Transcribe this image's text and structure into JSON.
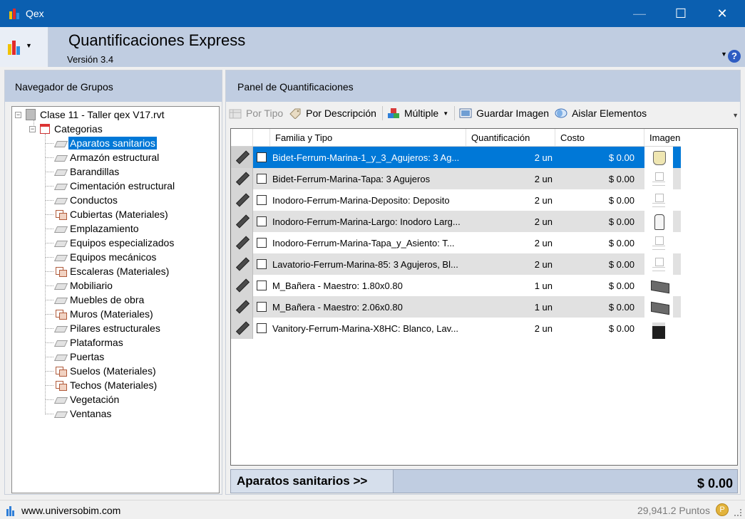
{
  "window": {
    "title": "Qex",
    "minimize_glyph": "—",
    "maximize_glyph": "☐",
    "close_glyph": "✕"
  },
  "header": {
    "app_title": "Quantificaciones Express",
    "version": "Versión 3.4",
    "help_glyph": "?"
  },
  "left_panel": {
    "title": "Navegador de Grupos",
    "root": {
      "label": "Clase 11 - Taller qex V17.rvt",
      "icon": "building-icon"
    },
    "group": {
      "label": "Categorias",
      "icon": "calendar-icon"
    },
    "selected_category": "Aparatos sanitarios",
    "categories": [
      {
        "label": "Aparatos sanitarios",
        "icon": "category-icon"
      },
      {
        "label": "Armazón estructural",
        "icon": "category-icon"
      },
      {
        "label": "Barandillas",
        "icon": "category-icon"
      },
      {
        "label": "Cimentación estructural",
        "icon": "category-icon"
      },
      {
        "label": "Conductos",
        "icon": "category-icon"
      },
      {
        "label": "Cubiertas (Materiales)",
        "icon": "material-icon"
      },
      {
        "label": "Emplazamiento",
        "icon": "category-icon"
      },
      {
        "label": "Equipos especializados",
        "icon": "category-icon"
      },
      {
        "label": "Equipos mecánicos",
        "icon": "category-icon"
      },
      {
        "label": "Escaleras (Materiales)",
        "icon": "material-icon"
      },
      {
        "label": "Mobiliario",
        "icon": "category-icon"
      },
      {
        "label": "Muebles de obra",
        "icon": "category-icon"
      },
      {
        "label": "Muros (Materiales)",
        "icon": "material-icon"
      },
      {
        "label": "Pilares estructurales",
        "icon": "category-icon"
      },
      {
        "label": "Plataformas",
        "icon": "category-icon"
      },
      {
        "label": "Puertas",
        "icon": "category-icon"
      },
      {
        "label": "Suelos (Materiales)",
        "icon": "material-icon"
      },
      {
        "label": "Techos (Materiales)",
        "icon": "material-icon"
      },
      {
        "label": "Vegetación",
        "icon": "category-icon"
      },
      {
        "label": "Ventanas",
        "icon": "category-icon"
      }
    ]
  },
  "right_panel": {
    "title": "Panel de Quantificaciones",
    "toolbar": {
      "por_tipo": "Por Tipo",
      "por_descripcion": "Por Descripción",
      "multiple": "Múltiple",
      "guardar_imagen": "Guardar Imagen",
      "aislar_elementos": "Aislar Elementos"
    },
    "columns": {
      "familia": "Familia y Tipo",
      "cuantificacion": "Quantificación",
      "costo": "Costo",
      "imagen": "Imagen"
    },
    "rows": [
      {
        "familia": "Bidet-Ferrum-Marina-1_y_3_Agujeros: 3 Ag...",
        "qty": "2 un",
        "cost": "$ 0.00",
        "thumb": "bidet"
      },
      {
        "familia": "Bidet-Ferrum-Marina-Tapa: 3 Agujeros",
        "qty": "2 un",
        "cost": "$ 0.00",
        "thumb": "faded"
      },
      {
        "familia": "Inodoro-Ferrum-Marina-Deposito: Deposito",
        "qty": "2 un",
        "cost": "$ 0.00",
        "thumb": "faded"
      },
      {
        "familia": "Inodoro-Ferrum-Marina-Largo: Inodoro Larg...",
        "qty": "2 un",
        "cost": "$ 0.00",
        "thumb": "toilet"
      },
      {
        "familia": "Inodoro-Ferrum-Marina-Tapa_y_Asiento: T...",
        "qty": "2 un",
        "cost": "$ 0.00",
        "thumb": "faded"
      },
      {
        "familia": "Lavatorio-Ferrum-Marina-85: 3 Agujeros, Bl...",
        "qty": "2 un",
        "cost": "$ 0.00",
        "thumb": "faded"
      },
      {
        "familia": "M_Bañera - Maestro: 1.80x0.80",
        "qty": "1 un",
        "cost": "$ 0.00",
        "thumb": "tub"
      },
      {
        "familia": "M_Bañera - Maestro: 2.06x0.80",
        "qty": "1 un",
        "cost": "$ 0.00",
        "thumb": "tub"
      },
      {
        "familia": "Vanitory-Ferrum-Marina-X8HC: Blanco, Lav...",
        "qty": "2 un",
        "cost": "$ 0.00",
        "thumb": "vanity"
      }
    ],
    "selected_row": 0,
    "summary": {
      "category": "Aparatos sanitarios >>",
      "total": "$ 0.00"
    }
  },
  "statusbar": {
    "url": "www.universobim.com",
    "points": "29,941.2 Puntos"
  },
  "colors": {
    "titlebar": "#0b5fb0",
    "header": "#c0cde1",
    "selection": "#0078d7",
    "alt_row": "#e1e1e1"
  }
}
